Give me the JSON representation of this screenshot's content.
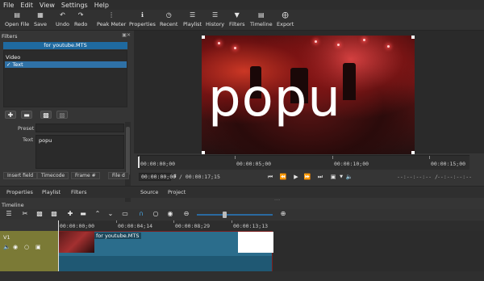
{
  "menu": [
    "File",
    "Edit",
    "View",
    "Settings",
    "Help"
  ],
  "toolbar": [
    {
      "label": "Open File",
      "icon": "folder-icon"
    },
    {
      "label": "Save",
      "icon": "save-icon"
    },
    {
      "label": "Undo",
      "icon": "undo-icon"
    },
    {
      "label": "Redo",
      "icon": "redo-icon"
    },
    {
      "label": "Peak Meter",
      "icon": "peak-meter-icon"
    },
    {
      "label": "Properties",
      "icon": "info-icon"
    },
    {
      "label": "Recent",
      "icon": "clock-icon"
    },
    {
      "label": "Playlist",
      "icon": "list-icon"
    },
    {
      "label": "History",
      "icon": "history-icon"
    },
    {
      "label": "Filters",
      "icon": "funnel-icon"
    },
    {
      "label": "Timeline",
      "icon": "timeline-icon"
    },
    {
      "label": "Export",
      "icon": "export-icon"
    }
  ],
  "filters_panel": {
    "title": "Filters",
    "clip_name": "for youtube.MTS",
    "group": "Video",
    "item": "✓ Text",
    "preset_label": "Preset",
    "text_label": "Text",
    "text_value": "popu",
    "buttons": [
      "Insert field",
      "Timecode",
      "Frame #",
      "File d"
    ],
    "tabs": [
      "Properties",
      "Playlist",
      "Filters"
    ]
  },
  "viewer": {
    "overlay_text": "popu",
    "ruler": [
      "00:00:00;00",
      "00:00:05;00",
      "00:00:10;00",
      "00:00:15;00"
    ],
    "position": "00:00:00;00",
    "duration": "/ 00:00:17;15",
    "in_point": "--:--:--:-- /",
    "out_point": "--:--:--:--",
    "tabs": [
      "Source",
      "Project"
    ]
  },
  "timeline": {
    "title": "Timeline",
    "ruler": [
      "00:00:00;00",
      "00:00:04;14",
      "00:00:08;29",
      "00:00:13;13"
    ],
    "track_name": "V1",
    "clip_name": "for youtube.MTS"
  },
  "colors": {
    "selection": "#2f71a6",
    "track_head": "#7b7a36",
    "clip": "#2b6d8c"
  }
}
